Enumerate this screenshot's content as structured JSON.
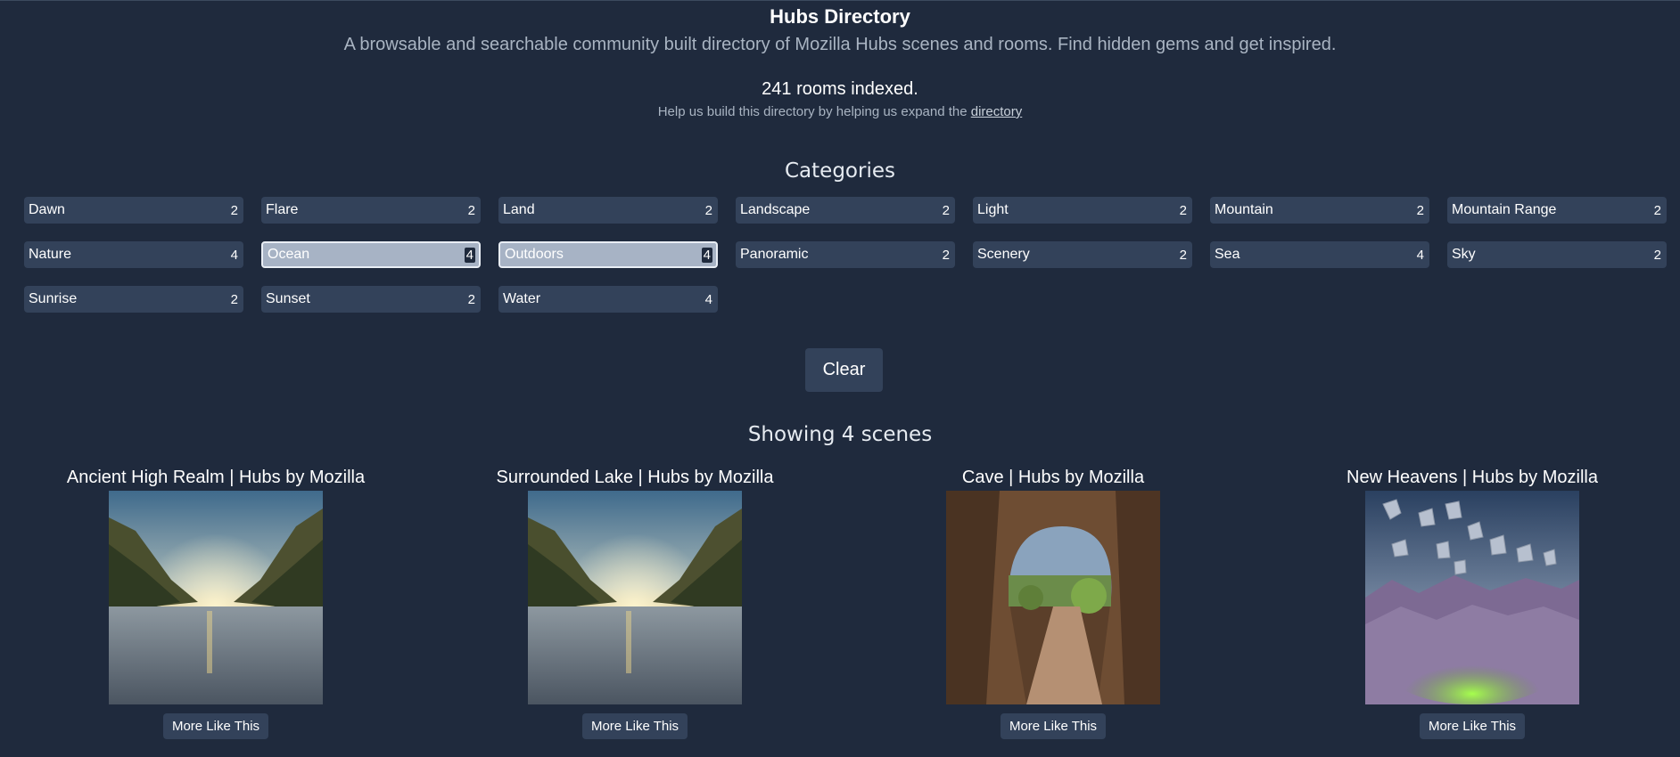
{
  "header": {
    "title": "Hubs Directory",
    "subtitle": "A browsable and searchable community built directory of Mozilla Hubs scenes and rooms. Find hidden gems and get inspired.",
    "rooms_indexed": "241 rooms indexed.",
    "help_text": "Help us build this directory by helping us expand the ",
    "help_link": "directory"
  },
  "categories": {
    "heading": "Categories",
    "items": [
      {
        "label": "Dawn",
        "count": "2",
        "active": false
      },
      {
        "label": "Flare",
        "count": "2",
        "active": false
      },
      {
        "label": "Land",
        "count": "2",
        "active": false
      },
      {
        "label": "Landscape",
        "count": "2",
        "active": false
      },
      {
        "label": "Light",
        "count": "2",
        "active": false
      },
      {
        "label": "Mountain",
        "count": "2",
        "active": false
      },
      {
        "label": "Mountain Range",
        "count": "2",
        "active": false
      },
      {
        "label": "Nature",
        "count": "4",
        "active": false
      },
      {
        "label": "Ocean",
        "count": "4",
        "active": true
      },
      {
        "label": "Outdoors",
        "count": "4",
        "active": true
      },
      {
        "label": "Panoramic",
        "count": "2",
        "active": false
      },
      {
        "label": "Scenery",
        "count": "2",
        "active": false
      },
      {
        "label": "Sea",
        "count": "4",
        "active": false
      },
      {
        "label": "Sky",
        "count": "2",
        "active": false
      },
      {
        "label": "Sunrise",
        "count": "2",
        "active": false
      },
      {
        "label": "Sunset",
        "count": "2",
        "active": false
      },
      {
        "label": "Water",
        "count": "4",
        "active": false
      }
    ],
    "clear_label": "Clear"
  },
  "results": {
    "showing": "Showing 4 scenes",
    "scenes": [
      {
        "title": "Ancient High Realm | Hubs by Mozilla",
        "thumb": "sunset-valley",
        "button": "More Like This"
      },
      {
        "title": "Surrounded Lake | Hubs by Mozilla",
        "thumb": "sunset-valley",
        "button": "More Like This"
      },
      {
        "title": "Cave | Hubs by Mozilla",
        "thumb": "cave",
        "button": "More Like This"
      },
      {
        "title": "New Heavens | Hubs by Mozilla",
        "thumb": "floating-rocks",
        "button": "More Like This"
      }
    ]
  }
}
